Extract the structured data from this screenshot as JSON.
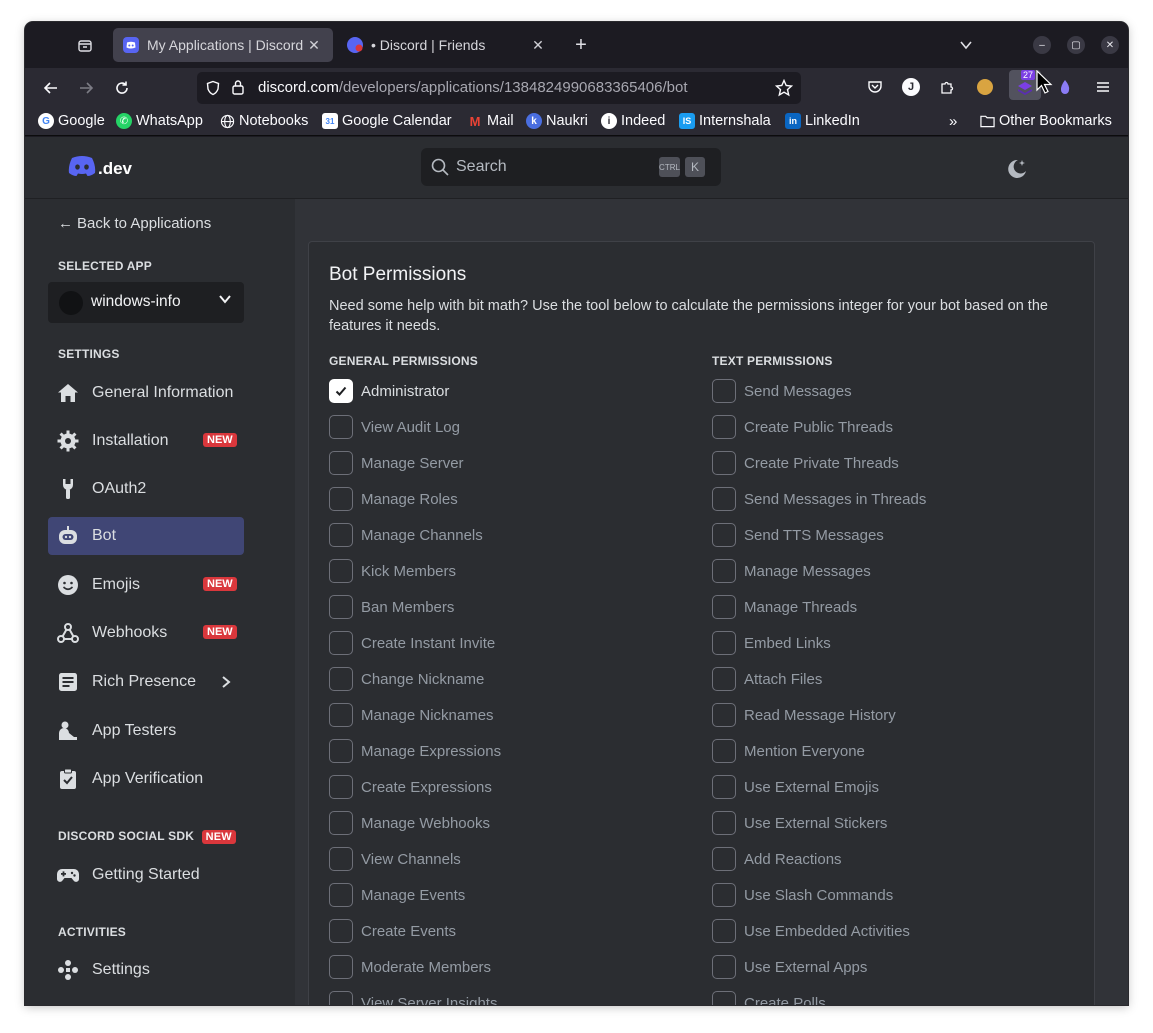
{
  "browser": {
    "tabs": [
      {
        "title": "My Applications | Discord",
        "active": true
      },
      {
        "title": "• Discord | Friends",
        "active": false
      }
    ],
    "url_host": "discord.com",
    "url_path": "/developers/applications/1384824990683365406/bot",
    "extension_badge": "27",
    "bookmarks": [
      "Google",
      "WhatsApp",
      "Notebooks",
      "Google Calendar",
      "Mail",
      "Naukri",
      "Indeed",
      "Internshala",
      "LinkedIn"
    ],
    "other_bookmarks": "Other Bookmarks"
  },
  "header": {
    "logo_text": ".dev",
    "search_placeholder": "Search",
    "kbd_ctrl": "CTRL",
    "kbd_k": "K"
  },
  "sidebar": {
    "back_label": "Back to Applications",
    "selected_app_heading": "SELECTED APP",
    "app_name": "windows-info",
    "settings_heading": "SETTINGS",
    "items": [
      {
        "label": "General Information",
        "badge": ""
      },
      {
        "label": "Installation",
        "badge": "NEW"
      },
      {
        "label": "OAuth2",
        "badge": ""
      },
      {
        "label": "Bot",
        "badge": ""
      },
      {
        "label": "Emojis",
        "badge": "NEW"
      },
      {
        "label": "Webhooks",
        "badge": "NEW"
      },
      {
        "label": "Rich Presence",
        "badge": ""
      },
      {
        "label": "App Testers",
        "badge": ""
      },
      {
        "label": "App Verification",
        "badge": ""
      }
    ],
    "sdk_heading": "DISCORD SOCIAL SDK",
    "sdk_badge": "NEW",
    "sdk_item": "Getting Started",
    "activities_heading": "ACTIVITIES",
    "activities_item": "Settings"
  },
  "panel": {
    "title": "Bot Permissions",
    "description": "Need some help with bit math? Use the tool below to calculate the permissions integer for your bot based on the features it needs.",
    "general_heading": "GENERAL PERMISSIONS",
    "text_heading": "TEXT PERMISSIONS",
    "general": [
      {
        "label": "Administrator",
        "checked": true
      },
      {
        "label": "View Audit Log",
        "checked": false
      },
      {
        "label": "Manage Server",
        "checked": false
      },
      {
        "label": "Manage Roles",
        "checked": false
      },
      {
        "label": "Manage Channels",
        "checked": false
      },
      {
        "label": "Kick Members",
        "checked": false
      },
      {
        "label": "Ban Members",
        "checked": false
      },
      {
        "label": "Create Instant Invite",
        "checked": false
      },
      {
        "label": "Change Nickname",
        "checked": false
      },
      {
        "label": "Manage Nicknames",
        "checked": false
      },
      {
        "label": "Manage Expressions",
        "checked": false
      },
      {
        "label": "Create Expressions",
        "checked": false
      },
      {
        "label": "Manage Webhooks",
        "checked": false
      },
      {
        "label": "View Channels",
        "checked": false
      },
      {
        "label": "Manage Events",
        "checked": false
      },
      {
        "label": "Create Events",
        "checked": false
      },
      {
        "label": "Moderate Members",
        "checked": false
      },
      {
        "label": "View Server Insights",
        "checked": false
      }
    ],
    "text": [
      {
        "label": "Send Messages",
        "checked": false
      },
      {
        "label": "Create Public Threads",
        "checked": false
      },
      {
        "label": "Create Private Threads",
        "checked": false
      },
      {
        "label": "Send Messages in Threads",
        "checked": false
      },
      {
        "label": "Send TTS Messages",
        "checked": false
      },
      {
        "label": "Manage Messages",
        "checked": false
      },
      {
        "label": "Manage Threads",
        "checked": false
      },
      {
        "label": "Embed Links",
        "checked": false
      },
      {
        "label": "Attach Files",
        "checked": false
      },
      {
        "label": "Read Message History",
        "checked": false
      },
      {
        "label": "Mention Everyone",
        "checked": false
      },
      {
        "label": "Use External Emojis",
        "checked": false
      },
      {
        "label": "Use External Stickers",
        "checked": false
      },
      {
        "label": "Add Reactions",
        "checked": false
      },
      {
        "label": "Use Slash Commands",
        "checked": false
      },
      {
        "label": "Use Embedded Activities",
        "checked": false
      },
      {
        "label": "Use External Apps",
        "checked": false
      },
      {
        "label": "Create Polls",
        "checked": false
      }
    ]
  },
  "colors": {
    "accent": "#5865f2",
    "active_nav": "#404675",
    "badge_red": "#da373c"
  }
}
